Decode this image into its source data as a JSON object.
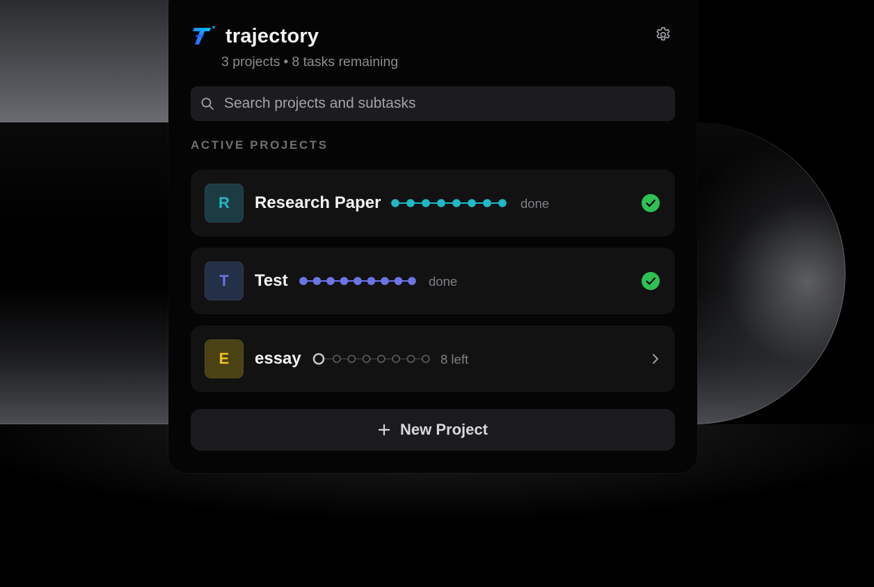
{
  "app": {
    "title": "trajectory",
    "subtitle_projects": "3 projects",
    "subtitle_separator": "•",
    "subtitle_tasks": "8 tasks remaining"
  },
  "search": {
    "placeholder": "Search projects and subtasks"
  },
  "section": {
    "title": "ACTIVE PROJECTS"
  },
  "projects": [
    {
      "initial": "R",
      "name": "Research Paper",
      "status": "done",
      "total_steps": 8,
      "completed_steps": 8,
      "accent": "#1fb8c6",
      "avatar_bg": "#1d3b43",
      "state_icon": "check-circle"
    },
    {
      "initial": "T",
      "name": "Test",
      "status": "done",
      "total_steps": 9,
      "completed_steps": 9,
      "accent": "#6c74e6",
      "avatar_bg": "#233047",
      "state_icon": "check-circle"
    },
    {
      "initial": "E",
      "name": "essay",
      "status": "8 left",
      "total_steps": 8,
      "completed_steps": 0,
      "accent": "#f2c21b",
      "avatar_bg": "#4a4214",
      "state_icon": "chevron-right"
    }
  ],
  "actions": {
    "new_project_label": "New Project"
  },
  "colors": {
    "success": "#30c154",
    "logo_gradient_start": "#2f5cff",
    "logo_gradient_end": "#0ac3ff"
  }
}
